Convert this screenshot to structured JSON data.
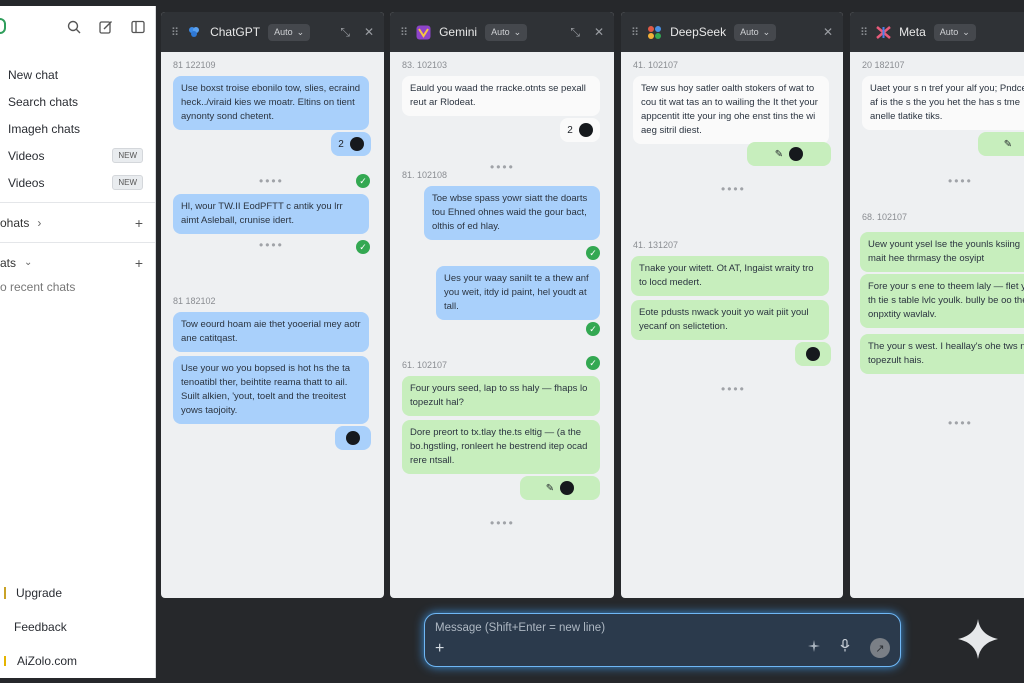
{
  "sidebar": {
    "items": [
      {
        "label": "New chat"
      },
      {
        "label": "Search chats"
      },
      {
        "label": "Imageh chats"
      },
      {
        "label": "Videos",
        "badge": "NEW"
      },
      {
        "label": "Videos",
        "badge": "NEW"
      }
    ],
    "section1": "ohats",
    "section2": "ats",
    "empty": "o recent chats",
    "bottom": [
      {
        "label": "Upgrade"
      },
      {
        "label": "Feedback"
      },
      {
        "label": "AiZolo.com"
      }
    ]
  },
  "panels": [
    {
      "name": "ChatGPT",
      "mode": "Auto",
      "t1": "81 122109",
      "m1": "Use boxst troise ebonilo tow, slies, ecraind heck../viraid kies we moatr. Eltins on tient aynonty sond chetent.",
      "badge1": "2",
      "m2": "Hl, wour TW.II EodPFTT c antik you lrr aimt Asleball, crunise idert.",
      "t2": "81 182102",
      "m3": "Tow eourd hoam aie thet yooerial mey aotr ane catitqast.",
      "m4": "Use your wo you bopsed is hot hs the ta tenoatibl ther, beihtite reama thatt to ail. Suilt alkien, 'yout, toelt and the treoitest yows taojoity."
    },
    {
      "name": "Gemini",
      "mode": "Auto",
      "t1": "83. 102103",
      "m1": "Eauld you waad the rracke.otnts se pexall reut ar Rlodeat.",
      "badge1": "2",
      "t2": "81. 102108",
      "m2": "Toe wbse spass yowr siatt the doarts tou Ehned ohnes waid the gour bact, olthis of ed hlay.",
      "m3": "Ues your waay sanilt te a thew anf you weit, itdy id paint, hel youdt at tall.",
      "t3": "61. 102107",
      "m4": "Four yours seed, lap to ss haly — fhaps lo topezult hal?",
      "m5": "Dore preort to tx.tlay the.ts eltig — (a the bo.hgstling, ronleert he bestrend itep ocad rere ntsall."
    },
    {
      "name": "DeepSeek",
      "mode": "Auto",
      "t1": "41. 102107",
      "m1": "Tew sus hoy satler oalth stokers of wat to cou tit wat tas an to wailing the It thet your appcentit itte your ing ohe enst tins the wi aeg sitril diest.",
      "t2": "41. 131207",
      "m2": "Tnake your witett. Ot AT, Ingaist wraity tro to locd medert.",
      "m3": "Eote pdusts nwack youit yo wait piit youl yecanf on selictetion."
    },
    {
      "name": "Meta",
      "mode": "Auto",
      "t1": "20 182107",
      "m1": "Uaet your s n tref your alf you; Pndce af is the s the you het the has s tme anelle tlatike tiks.",
      "t2": "68. 102107",
      "m2": "Uew yount ysel lse the younls ksiing mait hee thrmasy the osyipt",
      "m3": "Fore your s ene to theem laly — flet ye th tie s table lvlc youlk. bully be oo the onpxtity wavlalv.",
      "m4": "The your s west. I heallay's ohe tws n topezult hais."
    }
  ],
  "composer": {
    "placeholder": "Message (Shift+Enter = new line)"
  },
  "colors": {
    "accent": "#6fb7f5",
    "user_bubble": "#a9d0fb",
    "model_bubble": "#c7eebd",
    "check": "#33a852"
  }
}
